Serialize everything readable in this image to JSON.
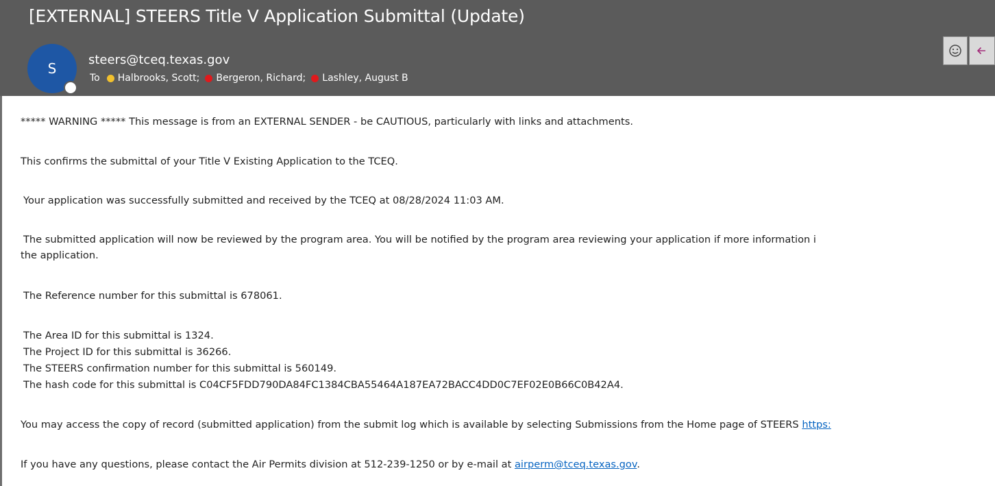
{
  "email": {
    "subject": "[EXTERNAL] STEERS Title V Application Submittal (Update)",
    "avatar_initial": "S",
    "sender": "steers@tceq.texas.gov",
    "to_label": "To",
    "recipients": [
      {
        "name": "Halbrooks, Scott;",
        "status_color": "#f2c12e"
      },
      {
        "name": "Bergeron, Richard;",
        "status_color": "#e0191c"
      },
      {
        "name": "Lashley, August B",
        "status_color": "#e0191c"
      }
    ]
  },
  "body": {
    "warning": "***** WARNING ***** This message is from an EXTERNAL SENDER - be CAUTIOUS, particularly with links and attachments.",
    "confirm": "This confirms the submittal of your Title V Existing Application to the TCEQ.",
    "received": "Your application was successfully submitted and received by the TCEQ at 08/28/2024 11:03 AM.",
    "review_line1": "The submitted application will now be reviewed by the program area. You will be notified by the program area reviewing your application if more information i",
    "review_line2": "the application.",
    "reference": "The Reference number for this submittal is 678061.",
    "area_id": "The Area ID for this submittal is 1324.",
    "project_id": "The Project ID for this submittal is 36266.",
    "steers_conf": "The STEERS confirmation number for this submittal is 560149.",
    "hash": "The hash code for this submittal is C04CF5FDD790DA84FC1384CBA55464A187EA72BACC4DD0C7EF02E0B66C0B42A4.",
    "access_text": "You may access the copy of record (submitted application) from the submit log which is available by selecting Submissions from the Home page of STEERS ",
    "access_link": "https:",
    "questions_text": "If you have any questions, please contact the Air Permits division at 512-239-1250 or by e-mail at ",
    "questions_link": "airperm@tceq.texas.gov",
    "questions_end": "."
  },
  "icons": {
    "emoji": "smiley-icon",
    "reply": "reply-arrow-icon"
  }
}
